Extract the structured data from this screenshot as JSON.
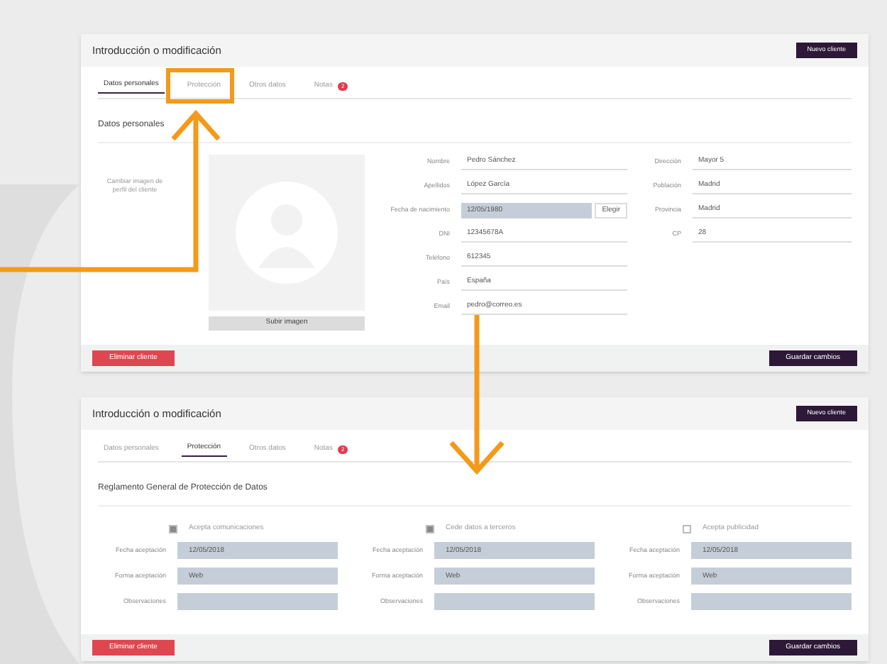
{
  "panels": [
    {
      "title": "Introducción o modificación",
      "header_button": "Nuevo cliente",
      "tabs": [
        {
          "label": "Datos personales",
          "selected": true
        },
        {
          "label": "Protección",
          "selected": false,
          "highlighted": true
        },
        {
          "label": "Otros datos",
          "selected": false
        },
        {
          "label": "Notas",
          "selected": false,
          "badge": "2"
        }
      ],
      "section_title": "Datos personales",
      "kind": "personal",
      "photo_note": "Cambiar imagen de perfil del cliente",
      "upload_button": "Subir imagen",
      "left_fields": [
        {
          "label": "Nombre",
          "value": "Pedro Sánchez"
        },
        {
          "label": "Apellidos",
          "value": "López García"
        },
        {
          "label": "Fecha de nacimiento",
          "value": "12/05/1980",
          "button": "Elegir",
          "filled": true
        },
        {
          "label": "DNI",
          "value": "12345678A"
        },
        {
          "label": "Teléfono",
          "value": "612345"
        },
        {
          "label": "País",
          "value": "España"
        },
        {
          "label": "Email",
          "value": "pedro@correo.es"
        }
      ],
      "right_fields": [
        {
          "label": "Dirección",
          "value": "Mayor 5"
        },
        {
          "label": "Población",
          "value": "Madrid"
        },
        {
          "label": "Provincia",
          "value": "Madrid"
        },
        {
          "label": "CP",
          "value": "28"
        }
      ],
      "delete_button": "Eliminar cliente",
      "save_button": "Guardar cambios"
    },
    {
      "title": "Introducción o modificación",
      "header_button": "Nuevo cliente",
      "tabs": [
        {
          "label": "Datos personales",
          "selected": false
        },
        {
          "label": "Protección",
          "selected": true
        },
        {
          "label": "Otros datos",
          "selected": false
        },
        {
          "label": "Notas",
          "selected": false,
          "badge": "2"
        }
      ],
      "section_title": "Reglamento General de Protección de Datos",
      "kind": "privacy",
      "columns": [
        {
          "heading": "Acepta comunicaciones",
          "checked": true,
          "rows": [
            {
              "label": "Fecha aceptación",
              "value": "12/05/2018"
            },
            {
              "label": "Forma aceptación",
              "value": "Web"
            },
            {
              "label": "Observaciones"
            }
          ]
        },
        {
          "heading": "Cede datos a terceros",
          "checked": true,
          "rows": [
            {
              "label": "Fecha aceptación",
              "value": "12/05/2018"
            },
            {
              "label": "Forma aceptación",
              "value": "Web"
            },
            {
              "label": "Observaciones"
            }
          ]
        },
        {
          "heading": "Acepta publicidad",
          "checked": false,
          "rows": [
            {
              "label": "Fecha aceptación",
              "value": "12/05/2018"
            },
            {
              "label": "Forma aceptación",
              "value": "Web"
            },
            {
              "label": "Observaciones"
            }
          ]
        }
      ],
      "delete_button": "Eliminar cliente",
      "save_button": "Guardar cambios"
    }
  ]
}
